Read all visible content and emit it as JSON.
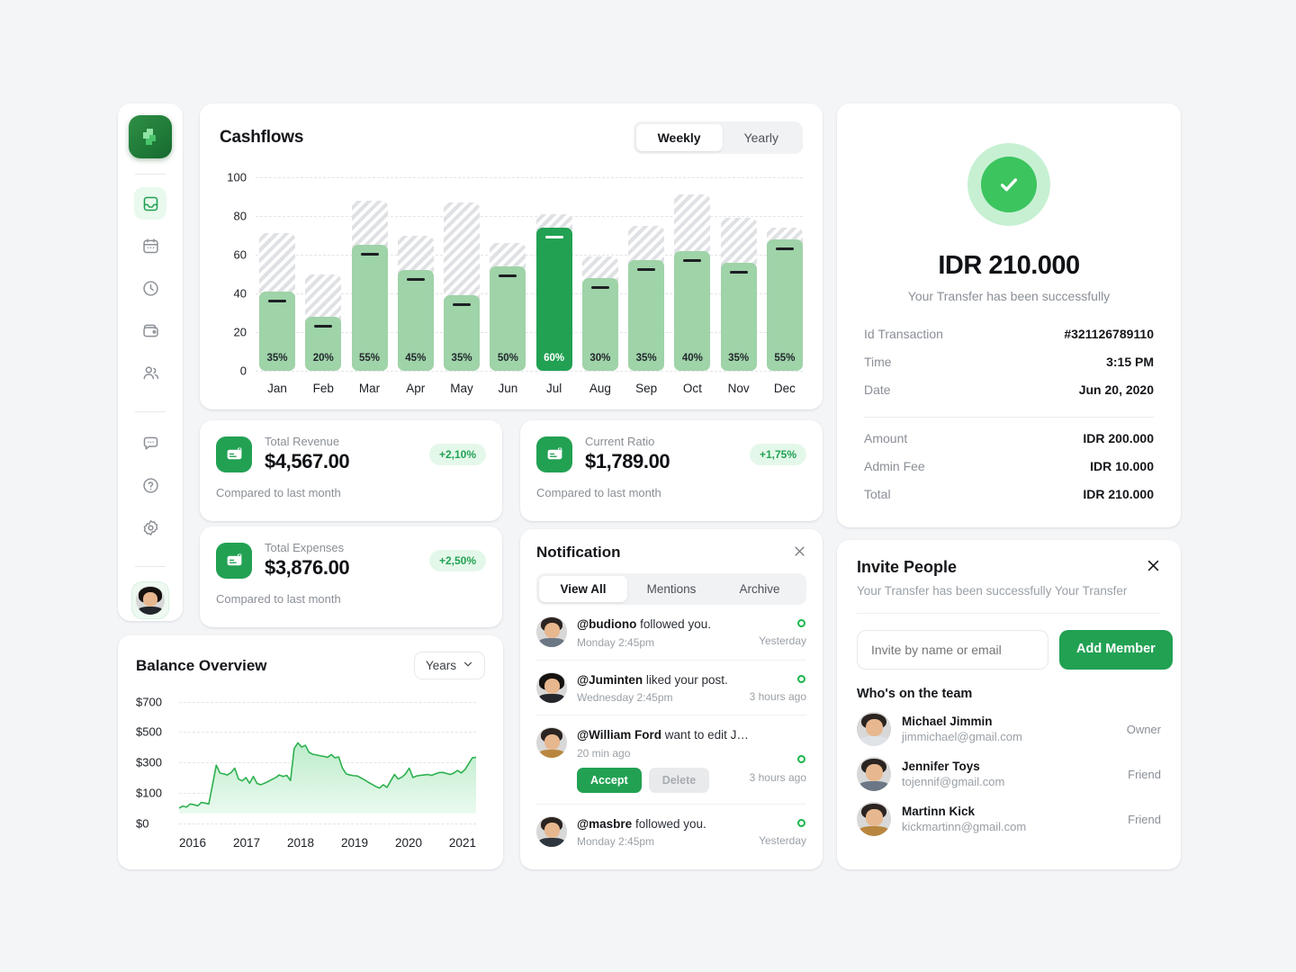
{
  "sidebar": {
    "logo_icon": "app-logo-icon",
    "items": [
      {
        "icon": "inbox-icon",
        "name": "inbox",
        "active": true
      },
      {
        "icon": "calendar-icon",
        "name": "calendar",
        "active": false
      },
      {
        "icon": "clock-icon",
        "name": "clock",
        "active": false
      },
      {
        "icon": "wallet-icon",
        "name": "wallet",
        "active": false
      },
      {
        "icon": "users-icon",
        "name": "users",
        "active": false
      }
    ],
    "bottom_items": [
      {
        "icon": "chat-icon",
        "name": "chat"
      },
      {
        "icon": "help-icon",
        "name": "help"
      },
      {
        "icon": "gear-icon",
        "name": "settings"
      }
    ],
    "avatar_name": "user-avatar"
  },
  "cashflows": {
    "title": "Cashflows",
    "range_options": [
      "Weekly",
      "Yearly"
    ],
    "active_range": "Weekly"
  },
  "chart_data": [
    {
      "type": "bar",
      "title": "Cashflows",
      "categories": [
        "Jan",
        "Feb",
        "Mar",
        "Apr",
        "May",
        "Jun",
        "Jul",
        "Aug",
        "Sep",
        "Oct",
        "Nov",
        "Dec"
      ],
      "values": [
        41,
        28,
        65,
        52,
        39,
        54,
        74,
        48,
        57,
        62,
        56,
        68
      ],
      "totals": [
        71,
        50,
        88,
        70,
        87,
        66,
        81,
        59,
        75,
        91,
        79,
        74
      ],
      "labels": [
        "35%",
        "20%",
        "55%",
        "45%",
        "35%",
        "50%",
        "60%",
        "30%",
        "35%",
        "40%",
        "35%",
        "55%"
      ],
      "highlight_index": 6,
      "ylim": [
        0,
        100
      ],
      "yticks": [
        0,
        20,
        40,
        60,
        80,
        100
      ],
      "xlabel": "",
      "ylabel": "",
      "grid": true,
      "legend": "none",
      "bar_color": "#9fd3a8",
      "highlight_color": "#22a153",
      "ghost_color": "#f2f3f4"
    },
    {
      "type": "area",
      "title": "Balance Overview",
      "xlabel": "",
      "ylabel": "",
      "xticks": [
        "2016",
        "2017",
        "2018",
        "2019",
        "2020",
        "2021"
      ],
      "yticks": [
        "$0",
        "$100",
        "$300",
        "$500",
        "$700"
      ],
      "ytick_values": [
        0,
        100,
        300,
        500,
        700
      ],
      "ylim": [
        0,
        700
      ],
      "grid": true,
      "line_color": "#2db14f",
      "fill_color": "#d8f2de",
      "values": [
        35,
        48,
        42,
        62,
        58,
        50,
        72,
        68,
        62,
        190,
        320,
        268,
        262,
        255,
        270,
        300,
        228,
        215,
        238,
        200,
        245,
        198,
        190,
        200,
        212,
        225,
        238,
        255,
        245,
        252,
        218,
        430,
        468,
        440,
        452,
        405,
        392,
        388,
        382,
        378,
        372,
        390,
        368,
        375,
        300,
        262,
        255,
        250,
        248,
        235,
        222,
        206,
        192,
        178,
        168,
        190,
        172,
        215,
        258,
        228,
        240,
        262,
        300,
        238,
        248,
        252,
        255,
        258,
        252,
        262,
        270,
        272,
        265,
        258,
        268,
        285,
        268,
        290,
        330,
        368,
        372
      ]
    }
  ],
  "balance": {
    "title": "Balance Overview",
    "selector_label": "Years",
    "selector_icon": "chevron-down-icon"
  },
  "stats": [
    {
      "icon": "card-icon",
      "label": "Total Revenue",
      "value": "$4,567.00",
      "badge": "+2,10%",
      "footer": "Compared to last month"
    },
    {
      "icon": "card-icon",
      "label": "Current Ratio",
      "value": "$1,789.00",
      "badge": "+1,75%",
      "footer": "Compared to last month"
    },
    {
      "icon": "card-icon",
      "label": "Total Expenses",
      "value": "$3,876.00",
      "badge": "+2,50%",
      "footer": "Compared to last month"
    }
  ],
  "notification": {
    "title": "Notification",
    "close_icon": "close-icon",
    "tabs": [
      "View All",
      "Mentions",
      "Archive"
    ],
    "active_tab": "View All",
    "items": [
      {
        "user": "@budiono",
        "action": " followed you.",
        "time": "Monday 2:45pm",
        "when": "Yesterday",
        "unread": true,
        "has_actions": false
      },
      {
        "user": "@Juminten",
        "action": " liked your post.",
        "time": "Wednesday 2:45pm",
        "when": "3 hours ago",
        "unread": true,
        "has_actions": false
      },
      {
        "user": "@William Ford",
        "action": " want to edit James...",
        "time": "20 min ago",
        "when": "3 hours ago",
        "unread": true,
        "has_actions": true,
        "accept_label": "Accept",
        "delete_label": "Delete"
      },
      {
        "user": "@masbre",
        "action": " followed you.",
        "time": "Monday 2:45pm",
        "when": "Yesterday",
        "unread": true,
        "has_actions": false
      }
    ]
  },
  "transfer": {
    "status_icon": "check-circle-icon",
    "amount": "IDR 210.000",
    "subtitle": "Your Transfer has been successfully",
    "rows_top": [
      {
        "key": "Id Transaction",
        "value": "#321126789110"
      },
      {
        "key": "Time",
        "value": "3:15 PM"
      },
      {
        "key": "Date",
        "value": "Jun 20, 2020"
      }
    ],
    "rows_bottom": [
      {
        "key": "Amount",
        "value": "IDR 200.000"
      },
      {
        "key": "Admin Fee",
        "value": "IDR 10.000"
      },
      {
        "key": "Total",
        "value": "IDR 210.000"
      }
    ]
  },
  "invite": {
    "title": "Invite People",
    "subtitle": "Your Transfer has been successfully Your Transfer",
    "close_icon": "close-icon",
    "input_placeholder": "Invite by name or email",
    "input_value": "",
    "add_label": "Add Member",
    "team_heading": "Who's on the team",
    "members": [
      {
        "name": "Michael Jimmin",
        "email": "jimmichael@gmail.com",
        "role": "Owner"
      },
      {
        "name": "Jennifer Toys",
        "email": "tojennif@gmail.com",
        "role": "Friend"
      },
      {
        "name": "Martinn Kick",
        "email": "kickmartinn@gmail.com",
        "role": "Friend"
      }
    ]
  },
  "theme": {
    "accent": "#22a153",
    "accent_light": "#9fd3a8",
    "accent_pale": "#e4f8ea",
    "page_bg": "#f4f5f7"
  }
}
